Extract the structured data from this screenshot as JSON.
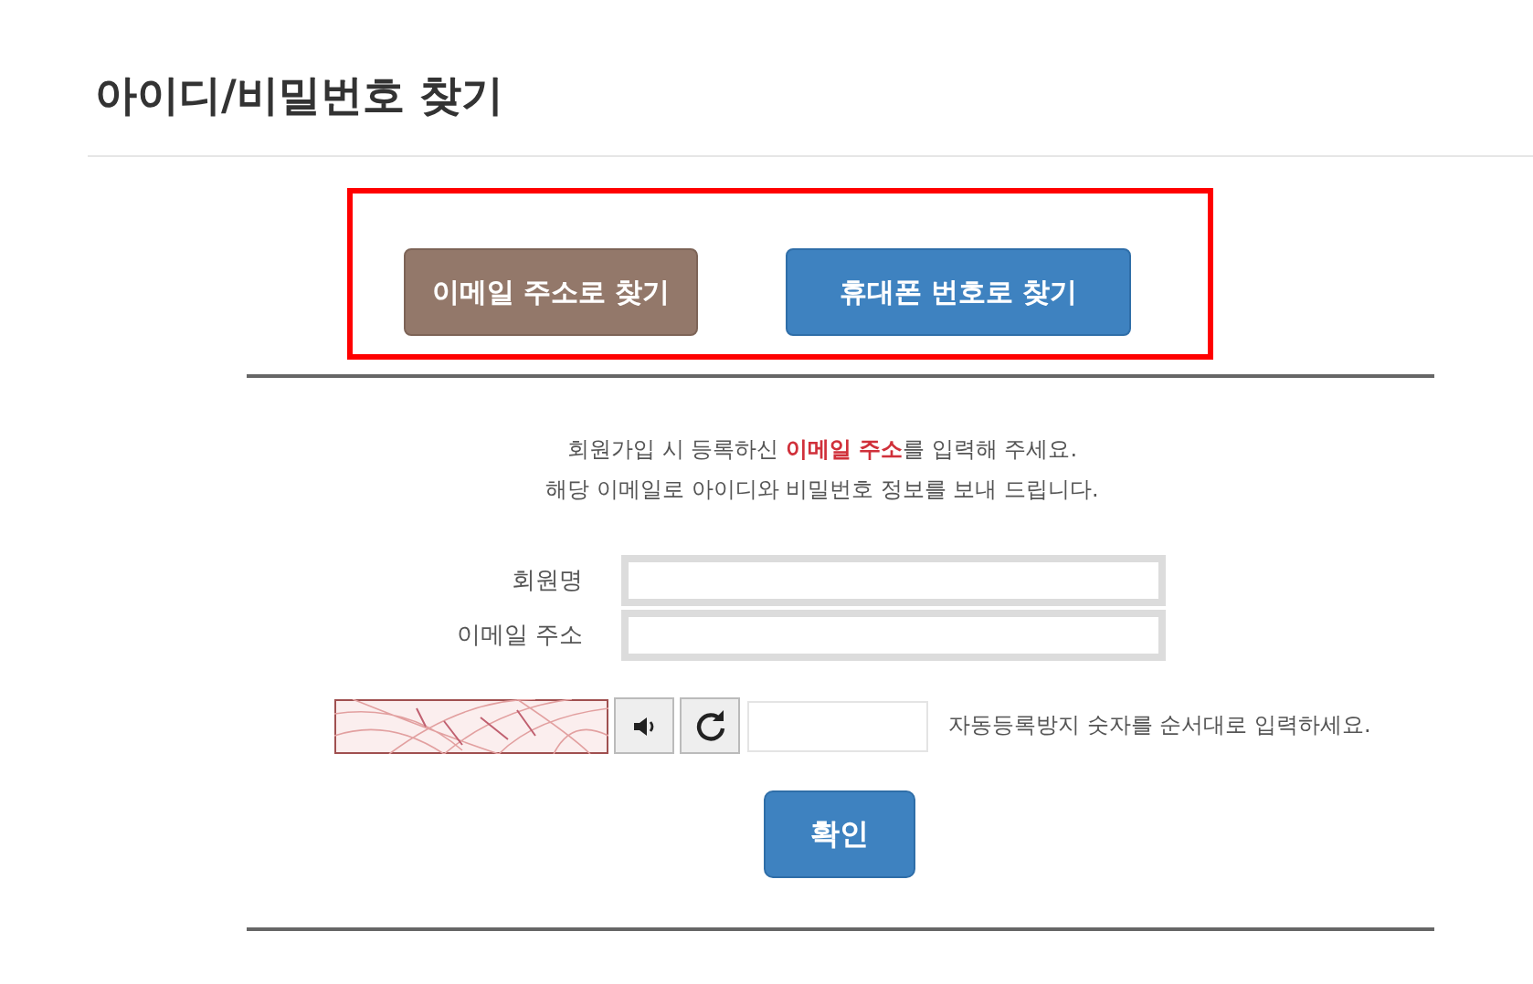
{
  "page_title": "아이디/비밀번호 찾기",
  "tabs": [
    {
      "label": "이메일 주소로 찾기",
      "selected": true
    },
    {
      "label": "휴대폰 번호로 찾기",
      "selected": false
    }
  ],
  "highlight": {
    "shown": true
  },
  "instructions": [
    "회원가입 시 등록하신 **이메일 주소**를 입력해 주세요.",
    "해당 이메일로 아이디와 비밀번호 정보를 보내 드립니다."
  ],
  "fields": [
    {
      "label": "회원명"
    },
    {
      "label": "이메일 주소"
    }
  ],
  "captcha": {
    "hint": "자동등록방지 숫자를 순서대로 입력하세요."
  },
  "submit": "확인"
}
